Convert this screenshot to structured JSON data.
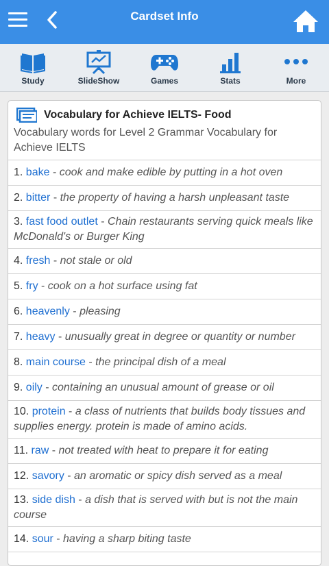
{
  "header": {
    "title": "Cardset Info"
  },
  "toolbar": {
    "items": [
      {
        "label": "Study",
        "icon": "book-icon"
      },
      {
        "label": "SlideShow",
        "icon": "presentation-icon"
      },
      {
        "label": "Games",
        "icon": "gamepad-icon"
      },
      {
        "label": "Stats",
        "icon": "bar-chart-icon"
      },
      {
        "label": "More",
        "icon": "more-dots-icon"
      }
    ]
  },
  "colors": {
    "accent": "#3a8ee6",
    "toolbar_icon": "#1f77d0",
    "term": "#1f6fd1"
  },
  "cardset": {
    "title": "Vocabulary for Achieve IELTS- Food",
    "description": "Vocabulary words for Level 2 Grammar Vocabulary for Achieve IELTS",
    "items": [
      {
        "num": "1.",
        "term": "bake",
        "def": "cook and make edible by putting in a hot oven"
      },
      {
        "num": "2.",
        "term": "bitter",
        "def": "the property of having a harsh unpleasant taste"
      },
      {
        "num": "3.",
        "term": "fast food outlet",
        "def": "Chain restaurants serving quick meals like McDonald's or Burger King"
      },
      {
        "num": "4.",
        "term": "fresh",
        "def": "not stale or old"
      },
      {
        "num": "5.",
        "term": "fry",
        "def": "cook on a hot surface using fat"
      },
      {
        "num": "6.",
        "term": "heavenly",
        "def": "pleasing"
      },
      {
        "num": "7.",
        "term": "heavy",
        "def": "unusually great in degree or quantity or number"
      },
      {
        "num": "8.",
        "term": "main course",
        "def": "the principal dish of a meal"
      },
      {
        "num": "9.",
        "term": "oily",
        "def": "containing an unusual amount of grease or oil"
      },
      {
        "num": "10.",
        "term": "protein",
        "def": "a class of nutrients that builds body tissues and supplies energy. protein is made of amino acids."
      },
      {
        "num": "11.",
        "term": "raw",
        "def": "not treated with heat to prepare it for eating"
      },
      {
        "num": "12.",
        "term": "savory",
        "def": "an aromatic or spicy dish served as a meal"
      },
      {
        "num": "13.",
        "term": "side dish",
        "def": "a dish that is served with but is not the main course"
      },
      {
        "num": "14.",
        "term": "sour",
        "def": "having a sharp biting taste"
      }
    ]
  }
}
